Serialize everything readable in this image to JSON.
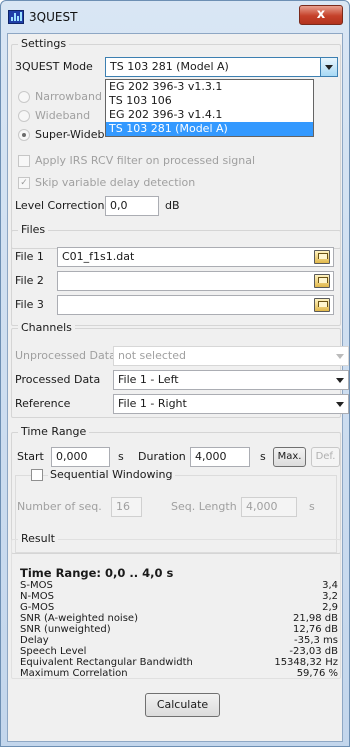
{
  "window": {
    "title": "3QUEST",
    "close_glyph": "x"
  },
  "settings": {
    "group_title": "Settings",
    "mode_label": "3QUEST Mode",
    "mode_value": "TS 103 281 (Model A)",
    "mode_options": [
      "EG 202 396-3 v1.3.1",
      "TS 103 106",
      "EG 202 396-3 v1.4.1",
      "TS 103 281 (Model A)"
    ],
    "radios": [
      {
        "label": "Narrowband",
        "checked": false
      },
      {
        "label": "Wideband",
        "checked": false
      },
      {
        "label": "Super-Wideb",
        "checked": true
      }
    ],
    "irs_label": "Apply IRS RCV filter on processed signal",
    "skip_label": "Skip variable delay detection",
    "level_label": "Level Correction",
    "level_value": "0,0",
    "level_unit": "dB"
  },
  "files": {
    "group_title": "Files",
    "rows": [
      {
        "label": "File 1",
        "value": "C01_f1s1.dat"
      },
      {
        "label": "File 2",
        "value": ""
      },
      {
        "label": "File 3",
        "value": ""
      }
    ]
  },
  "channels": {
    "group_title": "Channels",
    "rows": [
      {
        "label": "Unprocessed Data",
        "value": "not selected"
      },
      {
        "label": "Processed Data",
        "value": "File 1 - Left"
      },
      {
        "label": "Reference",
        "value": "File 1 - Right"
      }
    ]
  },
  "time_range": {
    "group_title": "Time Range",
    "start_label": "Start",
    "start_value": "0,000",
    "start_unit": "s",
    "duration_label": "Duration",
    "duration_value": "4,000",
    "duration_unit": "s",
    "max_label": "Max.",
    "def_label": "Def.",
    "seq_window_label": "Sequential Windowing",
    "num_seq_label": "Number of seq.",
    "num_seq_value": "16",
    "seq_length_label": "Seq. Length",
    "seq_length_value": "4,000",
    "seq_length_unit": "s"
  },
  "result": {
    "group_title": "Result",
    "heading": "Time Range: 0,0 .. 4,0 s",
    "rows": [
      {
        "label": "S-MOS",
        "value": "3,4"
      },
      {
        "label": "N-MOS",
        "value": "3,2"
      },
      {
        "label": "G-MOS",
        "value": "2,9"
      },
      {
        "label": "SNR (A-weighted noise)",
        "value": "21,98 dB"
      },
      {
        "label": "SNR (unweighted)",
        "value": "12,76 dB"
      },
      {
        "label": "Delay",
        "value": "-35,3 ms"
      },
      {
        "label": "Speech Level",
        "value": "-23,03 dB"
      },
      {
        "label": "Equivalent Rectangular Bandwidth",
        "value": "15348,32 Hz"
      },
      {
        "label": "Maximum Correlation",
        "value": "59,76 %"
      }
    ]
  },
  "calculate_label": "Calculate"
}
